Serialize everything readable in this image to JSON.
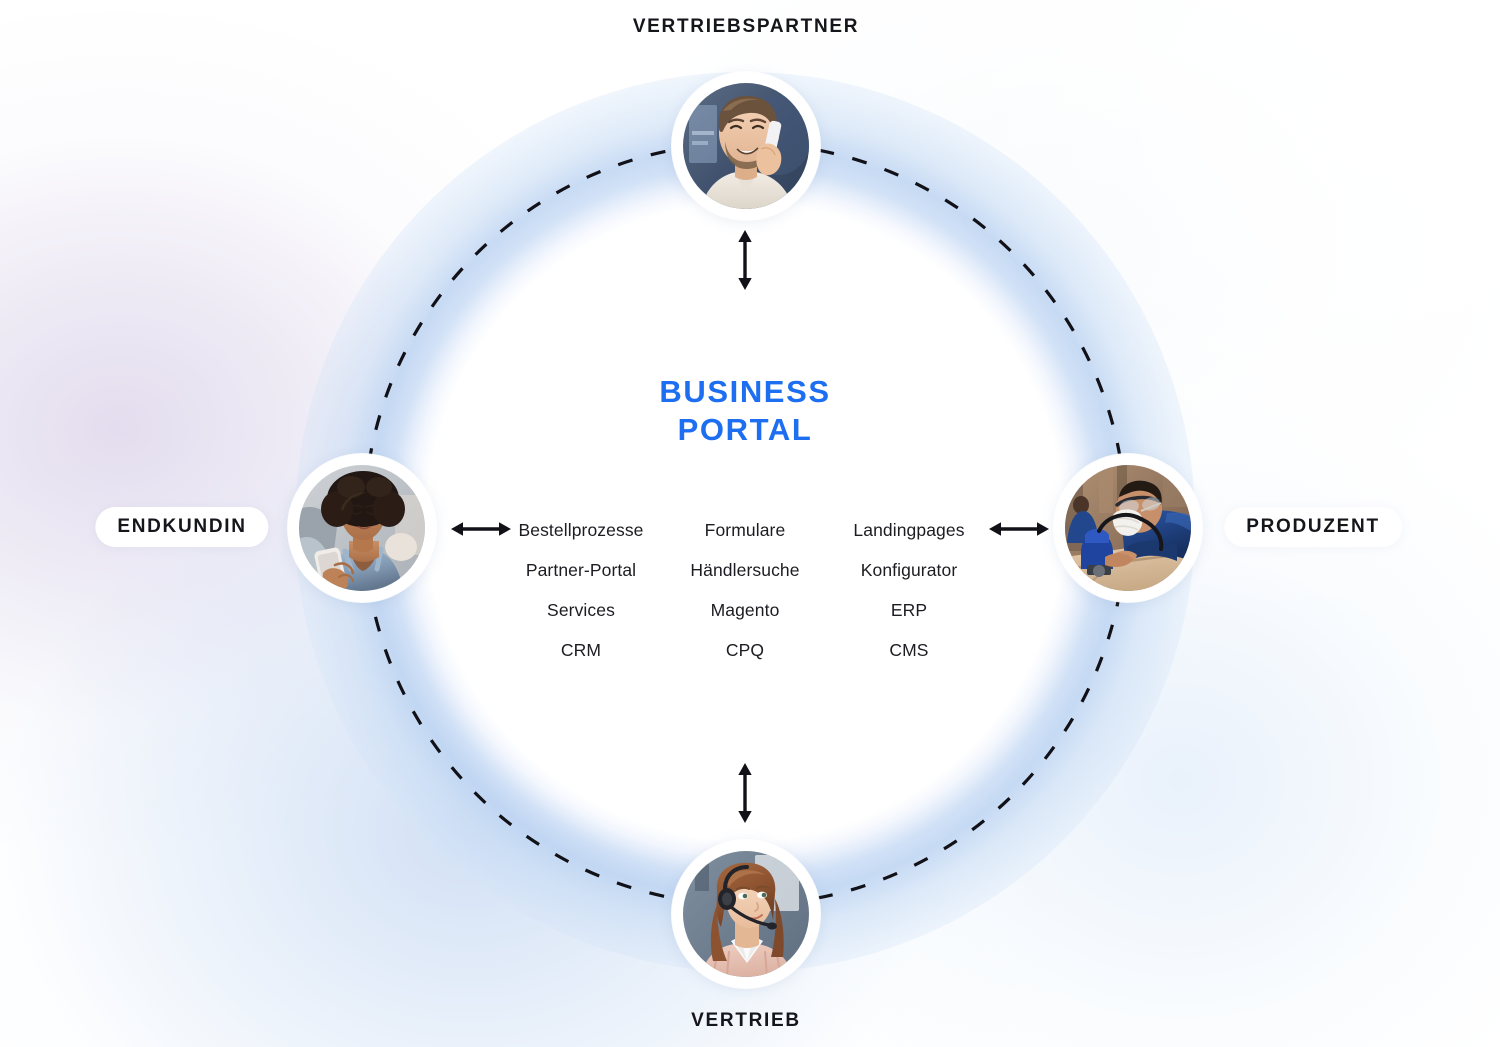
{
  "diagram": {
    "center": {
      "title_line1": "BUSINESS",
      "title_line2": "PORTAL",
      "title_color": "#1d6ef0",
      "features": [
        "Bestellprozesse",
        "Formulare",
        "Landingpages",
        "Partner-Portal",
        "Händlersuche",
        "Konfigurator",
        "Services",
        "Magento",
        "ERP",
        "CRM",
        "CPQ",
        "CMS"
      ]
    },
    "nodes": [
      {
        "id": "vertriebspartner",
        "label": "VERTRIEBSPARTNER",
        "position": "top",
        "avatar_name": "avatar-man-on-phone"
      },
      {
        "id": "produzent",
        "label": "PRODUZENT",
        "position": "right",
        "avatar_name": "avatar-craftsman-with-tool"
      },
      {
        "id": "vertrieb",
        "label": "VERTRIEB",
        "position": "bottom",
        "avatar_name": "avatar-woman-with-headset"
      },
      {
        "id": "endkundin",
        "label": "ENDKUNDIN",
        "position": "left",
        "avatar_name": "avatar-woman-with-smartphone"
      }
    ],
    "connectors": [
      {
        "id": "connector-top",
        "icon": "double-arrow-vertical"
      },
      {
        "id": "connector-right",
        "icon": "double-arrow-horizontal"
      },
      {
        "id": "connector-bottom",
        "icon": "double-arrow-vertical"
      },
      {
        "id": "connector-left",
        "icon": "double-arrow-horizontal"
      }
    ],
    "ring": {
      "icon": "dashed-circle",
      "color": "#111117"
    }
  }
}
